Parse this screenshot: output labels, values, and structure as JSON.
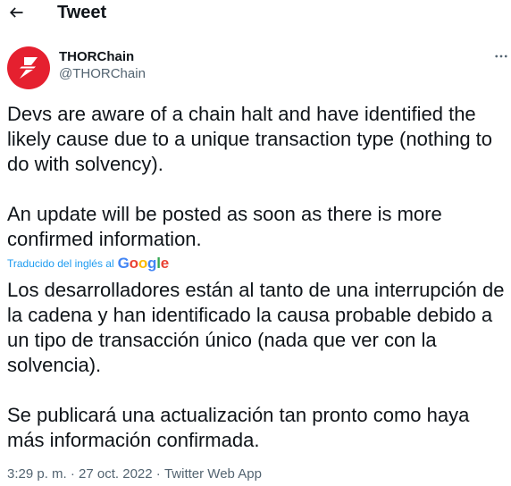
{
  "header": {
    "back_icon": "back-arrow-icon",
    "title": "Tweet"
  },
  "author": {
    "avatar_icon": "thorchain-logo-icon",
    "avatar_color": "#e5202f",
    "display_name": "THORChain",
    "handle": "@THORChain",
    "more_icon": "more-options-icon"
  },
  "tweet": {
    "text": "Devs are aware of a chain halt and have identified the likely cause due to a unique transaction type (nothing to do with solvency).\n\nAn update will be posted as soon as there is more confirmed information."
  },
  "translation": {
    "label": "Traducido del inglés al",
    "provider": "Google",
    "text": "Los desarrolladores están al tanto de una interrupción de la cadena y han identificado la causa probable debido a un tipo de transacción único (nada que ver con la solvencia).\n\nSe publicará una actualización tan pronto como haya más información confirmada."
  },
  "meta": {
    "time": "3:29 p. m.",
    "separator": " · ",
    "date": "27 oct. 2022",
    "source": "Twitter Web App"
  },
  "colors": {
    "link_blue": "#1d9bf0",
    "secondary_text": "#536471",
    "primary_text": "#0f1419"
  }
}
